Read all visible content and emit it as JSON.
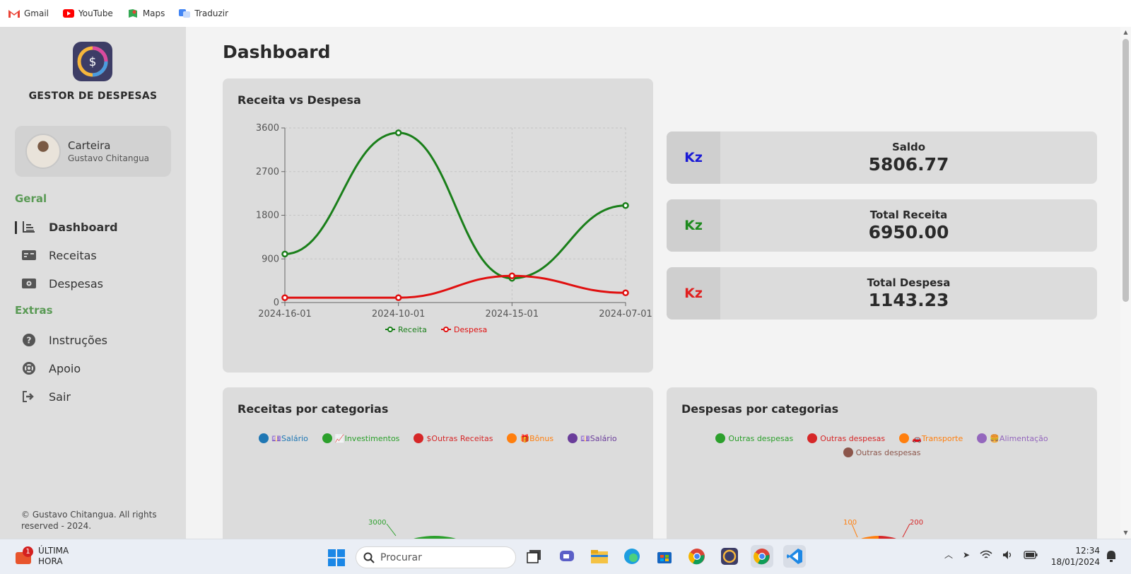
{
  "bookmarks": [
    {
      "label": "Gmail",
      "icon": "gmail-icon"
    },
    {
      "label": "YouTube",
      "icon": "youtube-icon"
    },
    {
      "label": "Maps",
      "icon": "maps-icon"
    },
    {
      "label": "Traduzir",
      "icon": "translate-icon"
    }
  ],
  "sidebar": {
    "brand": "GESTOR DE DESPESAS",
    "wallet": {
      "title": "Carteira",
      "user": "Gustavo Chitangua"
    },
    "section_general": "Geral",
    "section_extras": "Extras",
    "items": [
      {
        "label": "Dashboard",
        "icon": "chart-icon",
        "active": true
      },
      {
        "label": "Receitas",
        "icon": "money-bill-icon"
      },
      {
        "label": "Despesas",
        "icon": "money-icon"
      },
      {
        "label": "Instruções",
        "icon": "question-icon"
      },
      {
        "label": "Apoio",
        "icon": "lifebuoy-icon"
      },
      {
        "label": "Sair",
        "icon": "logout-icon"
      }
    ],
    "copyright": "© Gustavo Chitangua. All rights reserved - 2024."
  },
  "main": {
    "title": "Dashboard",
    "line_card_title": "Receita vs Despesa",
    "stats": [
      {
        "currency": "Kz",
        "label": "Saldo",
        "value": "5806.77",
        "color": "#1a1ad6"
      },
      {
        "currency": "Kz",
        "label": "Total Receita",
        "value": "6950.00",
        "color": "#1e8a1e"
      },
      {
        "currency": "Kz",
        "label": "Total Despesa",
        "value": "1143.23",
        "color": "#e02020"
      }
    ],
    "income_card_title": "Receitas por categorias",
    "expense_card_title": "Despesas por categorias",
    "income_legend": [
      {
        "label": "💷Salário",
        "color": "#1f77b4"
      },
      {
        "label": "📈Investimentos",
        "color": "#2ca02c"
      },
      {
        "label": "$Outras Receitas",
        "color": "#d62728"
      },
      {
        "label": "🎁Bônus",
        "color": "#ff7f0e"
      },
      {
        "label": "💷Salário",
        "color": "#6a3d9a"
      }
    ],
    "expense_legend": [
      {
        "label": "Outras despesas",
        "color": "#2ca02c"
      },
      {
        "label": "Outras despesas",
        "color": "#d62728"
      },
      {
        "label": "🚗Transporte",
        "color": "#ff7f0e"
      },
      {
        "label": "🍔Alimentação",
        "color": "#9467bd"
      },
      {
        "label": "Outras despesas",
        "color": "#8c564b"
      }
    ],
    "income_pie_label": "3000",
    "expense_pie_labels": [
      "100",
      "200"
    ]
  },
  "chart_data": {
    "type": "line",
    "categories": [
      "2024-16-01",
      "2024-10-01",
      "2024-15-01",
      "2024-07-01"
    ],
    "series": [
      {
        "name": "Receita",
        "values": [
          1000,
          3500,
          500,
          2000
        ],
        "color": "#1a7f1a"
      },
      {
        "name": "Despesa",
        "values": [
          100,
          100,
          550,
          200
        ],
        "color": "#e01010"
      }
    ],
    "yticks": [
      "0",
      "900",
      "1800",
      "2700",
      "3600"
    ],
    "ylim": [
      0,
      3600
    ],
    "grid": true,
    "legend": "bottom"
  },
  "taskbar": {
    "news_title": "ÚLTIMA",
    "news_sub": "HORA",
    "news_badge": "1",
    "search_placeholder": "Procurar",
    "time": "12:34",
    "date": "18/01/2024"
  }
}
